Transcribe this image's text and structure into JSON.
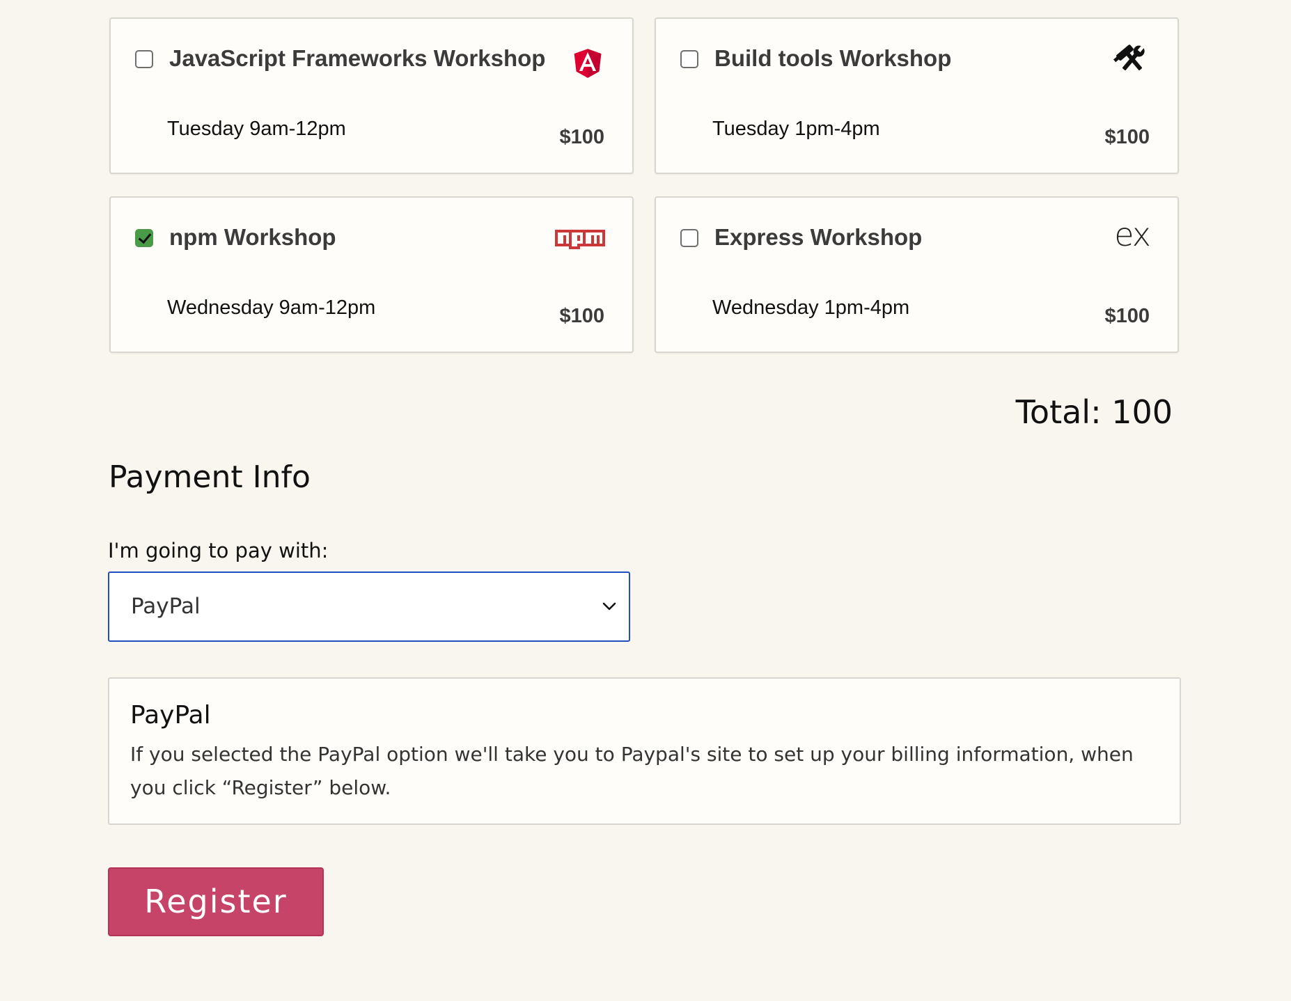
{
  "workshops": [
    {
      "title": "JavaScript Frameworks Workshop",
      "time": "Tuesday 9am-12pm",
      "price": "$100",
      "checked": false,
      "icon": "angular-icon"
    },
    {
      "title": "Build tools Workshop",
      "time": "Tuesday 1pm-4pm",
      "price": "$100",
      "checked": false,
      "icon": "tools-icon"
    },
    {
      "title": "npm Workshop",
      "time": "Wednesday 9am-12pm",
      "price": "$100",
      "checked": true,
      "icon": "npm-icon"
    },
    {
      "title": "Express Workshop",
      "time": "Wednesday 1pm-4pm",
      "price": "$100",
      "checked": false,
      "icon": "express-icon",
      "icon_text": "ex"
    }
  ],
  "total": {
    "label": "Total: 100"
  },
  "payment": {
    "heading": "Payment Info",
    "select_label": "I'm going to pay with:",
    "selected_method": "PayPal",
    "info_title": "PayPal",
    "info_text": "If you selected the PayPal option we'll take you to Paypal's site to set up your billing information, when you click “Register” below."
  },
  "register_button": {
    "label": "Register"
  },
  "colors": {
    "page_background": "#f9f5ef",
    "card_background": "#fffdf9",
    "checkbox_checked": "#4a9b47",
    "select_border": "#1f4fbf",
    "register_button": "#c54468",
    "angular_red": "#dd0031",
    "npm_red": "#cb3837"
  }
}
